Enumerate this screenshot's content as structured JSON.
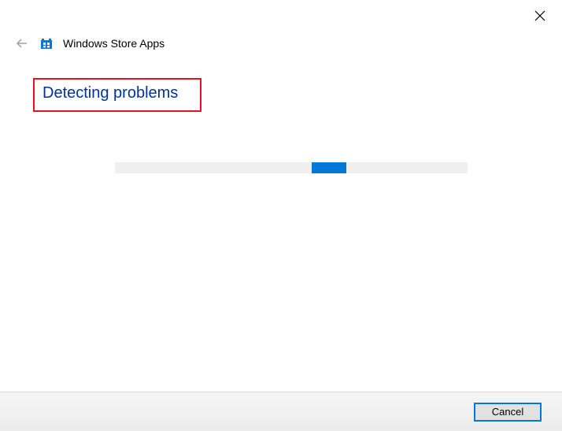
{
  "window": {
    "title": "Windows Store Apps"
  },
  "main": {
    "status": "Detecting problems"
  },
  "footer": {
    "cancel_label": "Cancel"
  },
  "colors": {
    "accent": "#0078d7",
    "highlight_border": "#e81123",
    "link_text": "#003399"
  }
}
